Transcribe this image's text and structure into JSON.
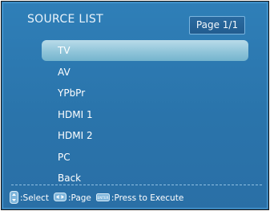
{
  "header": {
    "title": "SOURCE LIST",
    "page_indicator": "Page 1/1"
  },
  "sources": [
    {
      "label": "TV",
      "selected": true
    },
    {
      "label": "AV",
      "selected": false
    },
    {
      "label": "YPbPr",
      "selected": false
    },
    {
      "label": "HDMI 1",
      "selected": false
    },
    {
      "label": "HDMI 2",
      "selected": false
    },
    {
      "label": "PC",
      "selected": false
    },
    {
      "label": "Back",
      "selected": false
    }
  ],
  "footer": {
    "select_label": ":Select",
    "page_label": ":Page",
    "execute_label": ":Press to Execute",
    "enter_key_text": "ENTER"
  },
  "colors": {
    "background": "#2a74ab",
    "highlight": "#8dc3d8",
    "text": "#ffffff"
  },
  "icons": {
    "select": "up-down-arrows-icon",
    "page": "left-right-arrows-icon",
    "execute": "enter-key-icon"
  }
}
